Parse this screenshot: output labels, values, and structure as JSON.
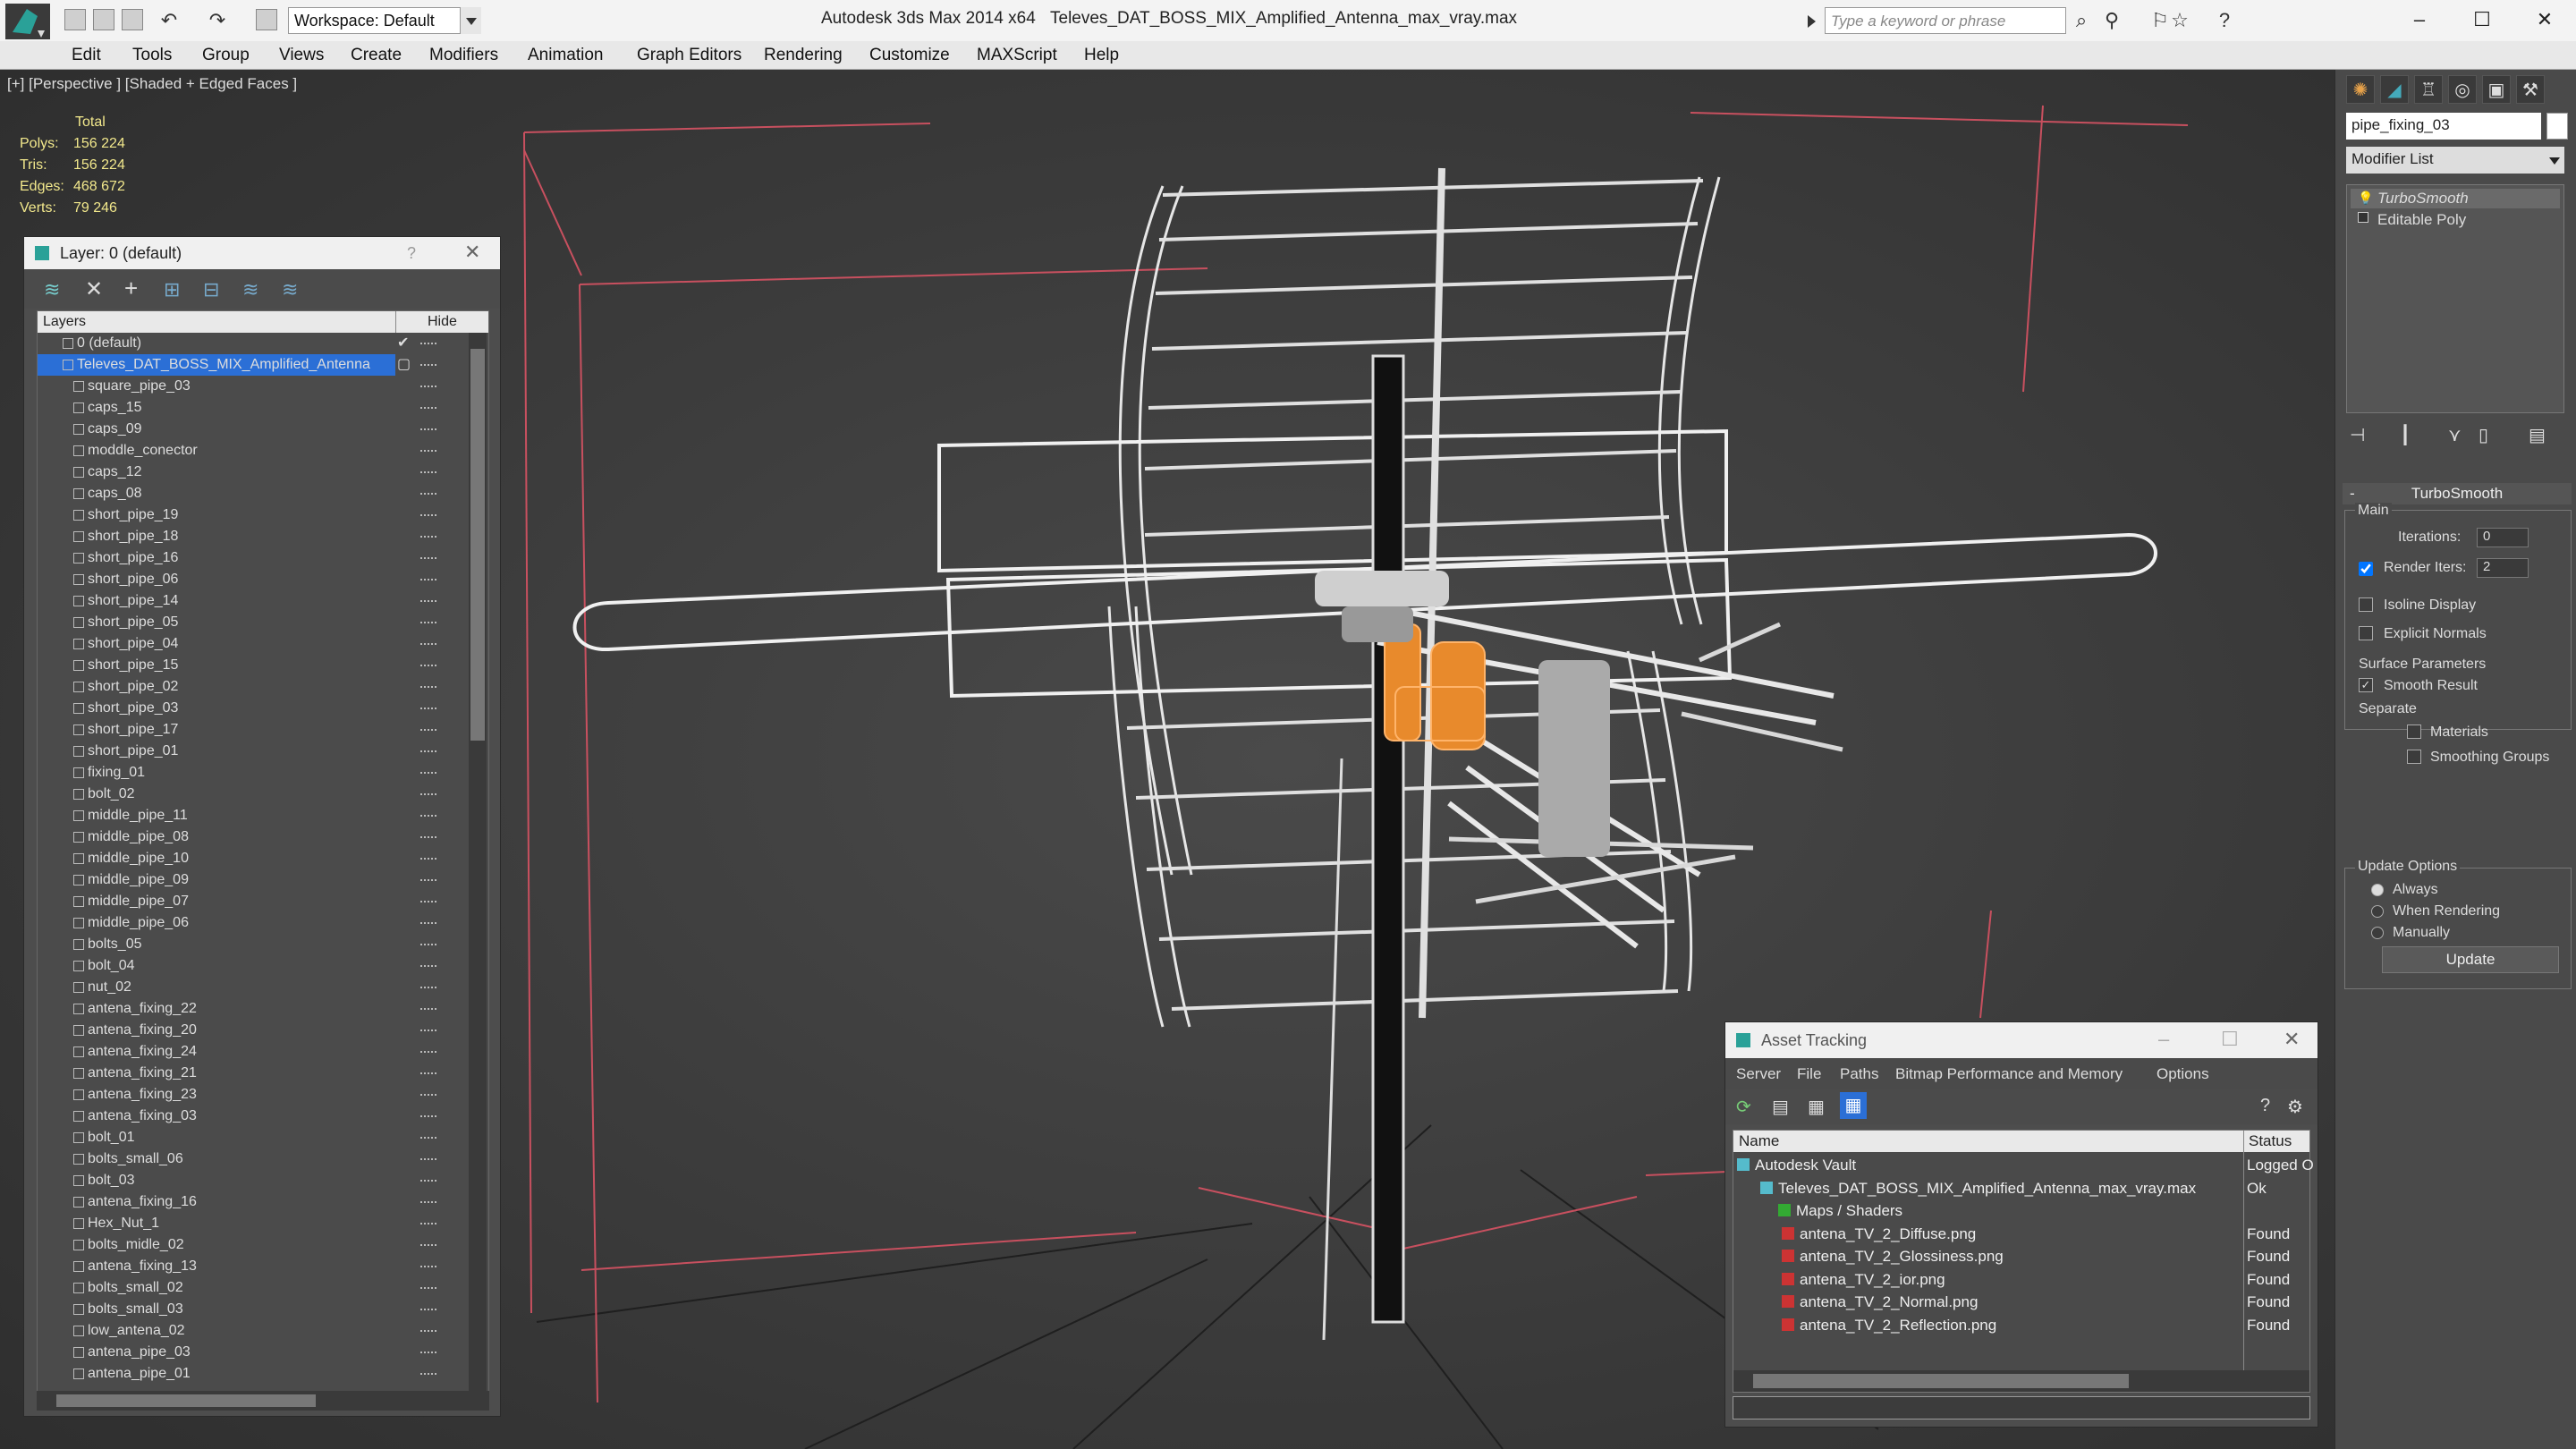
{
  "window": {
    "app_title": "Autodesk 3ds Max  2014 x64",
    "file_title": "Televes_DAT_BOSS_MIX_Amplified_Antenna_max_vray.max",
    "workspace": "Workspace: Default",
    "search_placeholder": "Type a keyword or phrase"
  },
  "menu": [
    "Edit",
    "Tools",
    "Group",
    "Views",
    "Create",
    "Modifiers",
    "Animation",
    "Graph Editors",
    "Rendering",
    "Customize",
    "MAXScript",
    "Help"
  ],
  "viewport": {
    "label": "[+] [Perspective ] [Shaded + Edged Faces ]",
    "stats_header": "Total",
    "stats": [
      {
        "label": "Polys:",
        "value": "156 224"
      },
      {
        "label": "Tris:",
        "value": "156 224"
      },
      {
        "label": "Edges:",
        "value": "468 672"
      },
      {
        "label": "Verts:",
        "value": "79 246"
      }
    ]
  },
  "layer_panel": {
    "title": "Layer: 0 (default)",
    "help": "?",
    "col_layers": "Layers",
    "col_hide": "Hide",
    "rows": [
      "0 (default)",
      "Televes_DAT_BOSS_MIX_Amplified_Antenna",
      "square_pipe_03",
      "caps_15",
      "caps_09",
      "moddle_conector",
      "caps_12",
      "caps_08",
      "short_pipe_19",
      "short_pipe_18",
      "short_pipe_16",
      "short_pipe_06",
      "short_pipe_14",
      "short_pipe_05",
      "short_pipe_04",
      "short_pipe_15",
      "short_pipe_02",
      "short_pipe_03",
      "short_pipe_17",
      "short_pipe_01",
      "fixing_01",
      "bolt_02",
      "middle_pipe_11",
      "middle_pipe_08",
      "middle_pipe_10",
      "middle_pipe_09",
      "middle_pipe_07",
      "middle_pipe_06",
      "bolts_05",
      "bolt_04",
      "nut_02",
      "antena_fixing_22",
      "antena_fixing_20",
      "antena_fixing_24",
      "antena_fixing_21",
      "antena_fixing_23",
      "antena_fixing_03",
      "bolt_01",
      "bolts_small_06",
      "bolt_03",
      "antena_fixing_16",
      "Hex_Nut_1",
      "bolts_midle_02",
      "antena_fixing_13",
      "bolts_small_02",
      "bolts_small_03",
      "low_antena_02",
      "antena_pipe_03",
      "antena_pipe_01"
    ]
  },
  "command_panel": {
    "object_name": "pipe_fixing_03",
    "modifier_list": "Modifier List",
    "stack": [
      "TurboSmooth",
      "Editable Poly"
    ],
    "rollout_title": "TurboSmooth",
    "main_group": "Main",
    "iterations_label": "Iterations:",
    "iterations_value": "0",
    "render_iters_label": "Render Iters:",
    "render_iters_value": "2",
    "isoline": "Isoline Display",
    "explicit_normals": "Explicit Normals",
    "surface_params": "Surface Parameters",
    "smooth_result": "Smooth Result",
    "separate": "Separate",
    "materials": "Materials",
    "smoothing_groups": "Smoothing Groups",
    "update_options": "Update Options",
    "always": "Always",
    "when_rendering": "When Rendering",
    "manually": "Manually",
    "update_button": "Update"
  },
  "asset_tracking": {
    "title": "Asset Tracking",
    "menu": [
      "Server",
      "File",
      "Paths",
      "Bitmap Performance and Memory",
      "Options"
    ],
    "col_name": "Name",
    "col_status": "Status",
    "rows": [
      {
        "name": "Autodesk Vault",
        "status": "Logged O"
      },
      {
        "name": "Televes_DAT_BOSS_MIX_Amplified_Antenna_max_vray.max",
        "status": "Ok"
      },
      {
        "name": "Maps / Shaders",
        "status": ""
      },
      {
        "name": "antena_TV_2_Diffuse.png",
        "status": "Found"
      },
      {
        "name": "antena_TV_2_Glossiness.png",
        "status": "Found"
      },
      {
        "name": "antena_TV_2_ior.png",
        "status": "Found"
      },
      {
        "name": "antena_TV_2_Normal.png",
        "status": "Found"
      },
      {
        "name": "antena_TV_2_Reflection.png",
        "status": "Found"
      }
    ]
  },
  "colors": {
    "accent": "#2b6fd6",
    "selection_orange": "#e88a2c",
    "grid_red": "#d05060"
  }
}
